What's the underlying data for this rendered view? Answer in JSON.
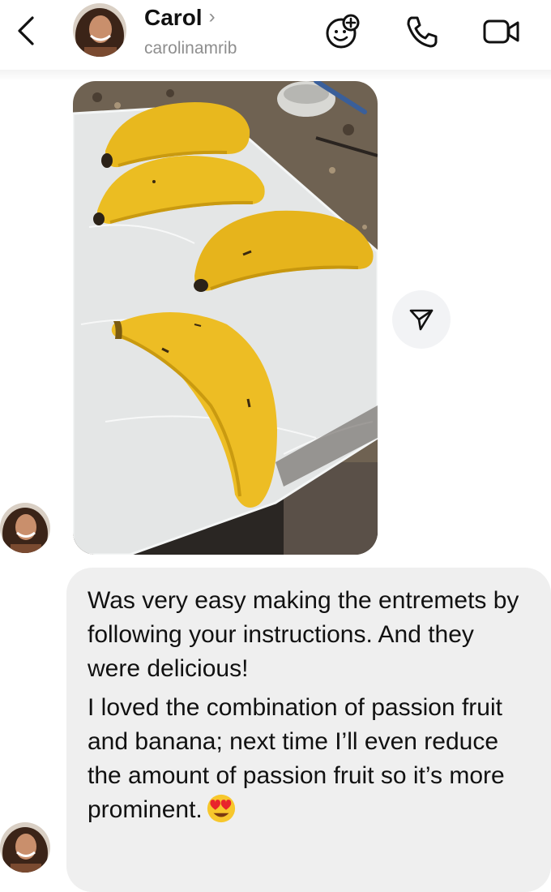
{
  "header": {
    "contact_name": "Carol",
    "name_chevron": "›",
    "username": "carolinamrib",
    "icons": [
      "back-chevron-icon",
      "sticker-add-icon",
      "phone-icon",
      "video-camera-icon"
    ]
  },
  "photo_message": {
    "description_icon": "banana-shaped-entremets-photo",
    "share_icon": "paper-plane-share-icon"
  },
  "text_message": {
    "paragraph_1": "Was very easy making the entremets by following your instructions. And they were delicious!",
    "paragraph_2": "I loved the combination of passion fruit and banana; next time I’ll even reduce the amount of passion fruit so it’s more prominent.",
    "emoji_icon": "heart-eyes-emoji"
  },
  "colors": {
    "bubble_bg": "#efefef",
    "secondary_text": "#8e8e8e",
    "primary_text": "#111111"
  }
}
